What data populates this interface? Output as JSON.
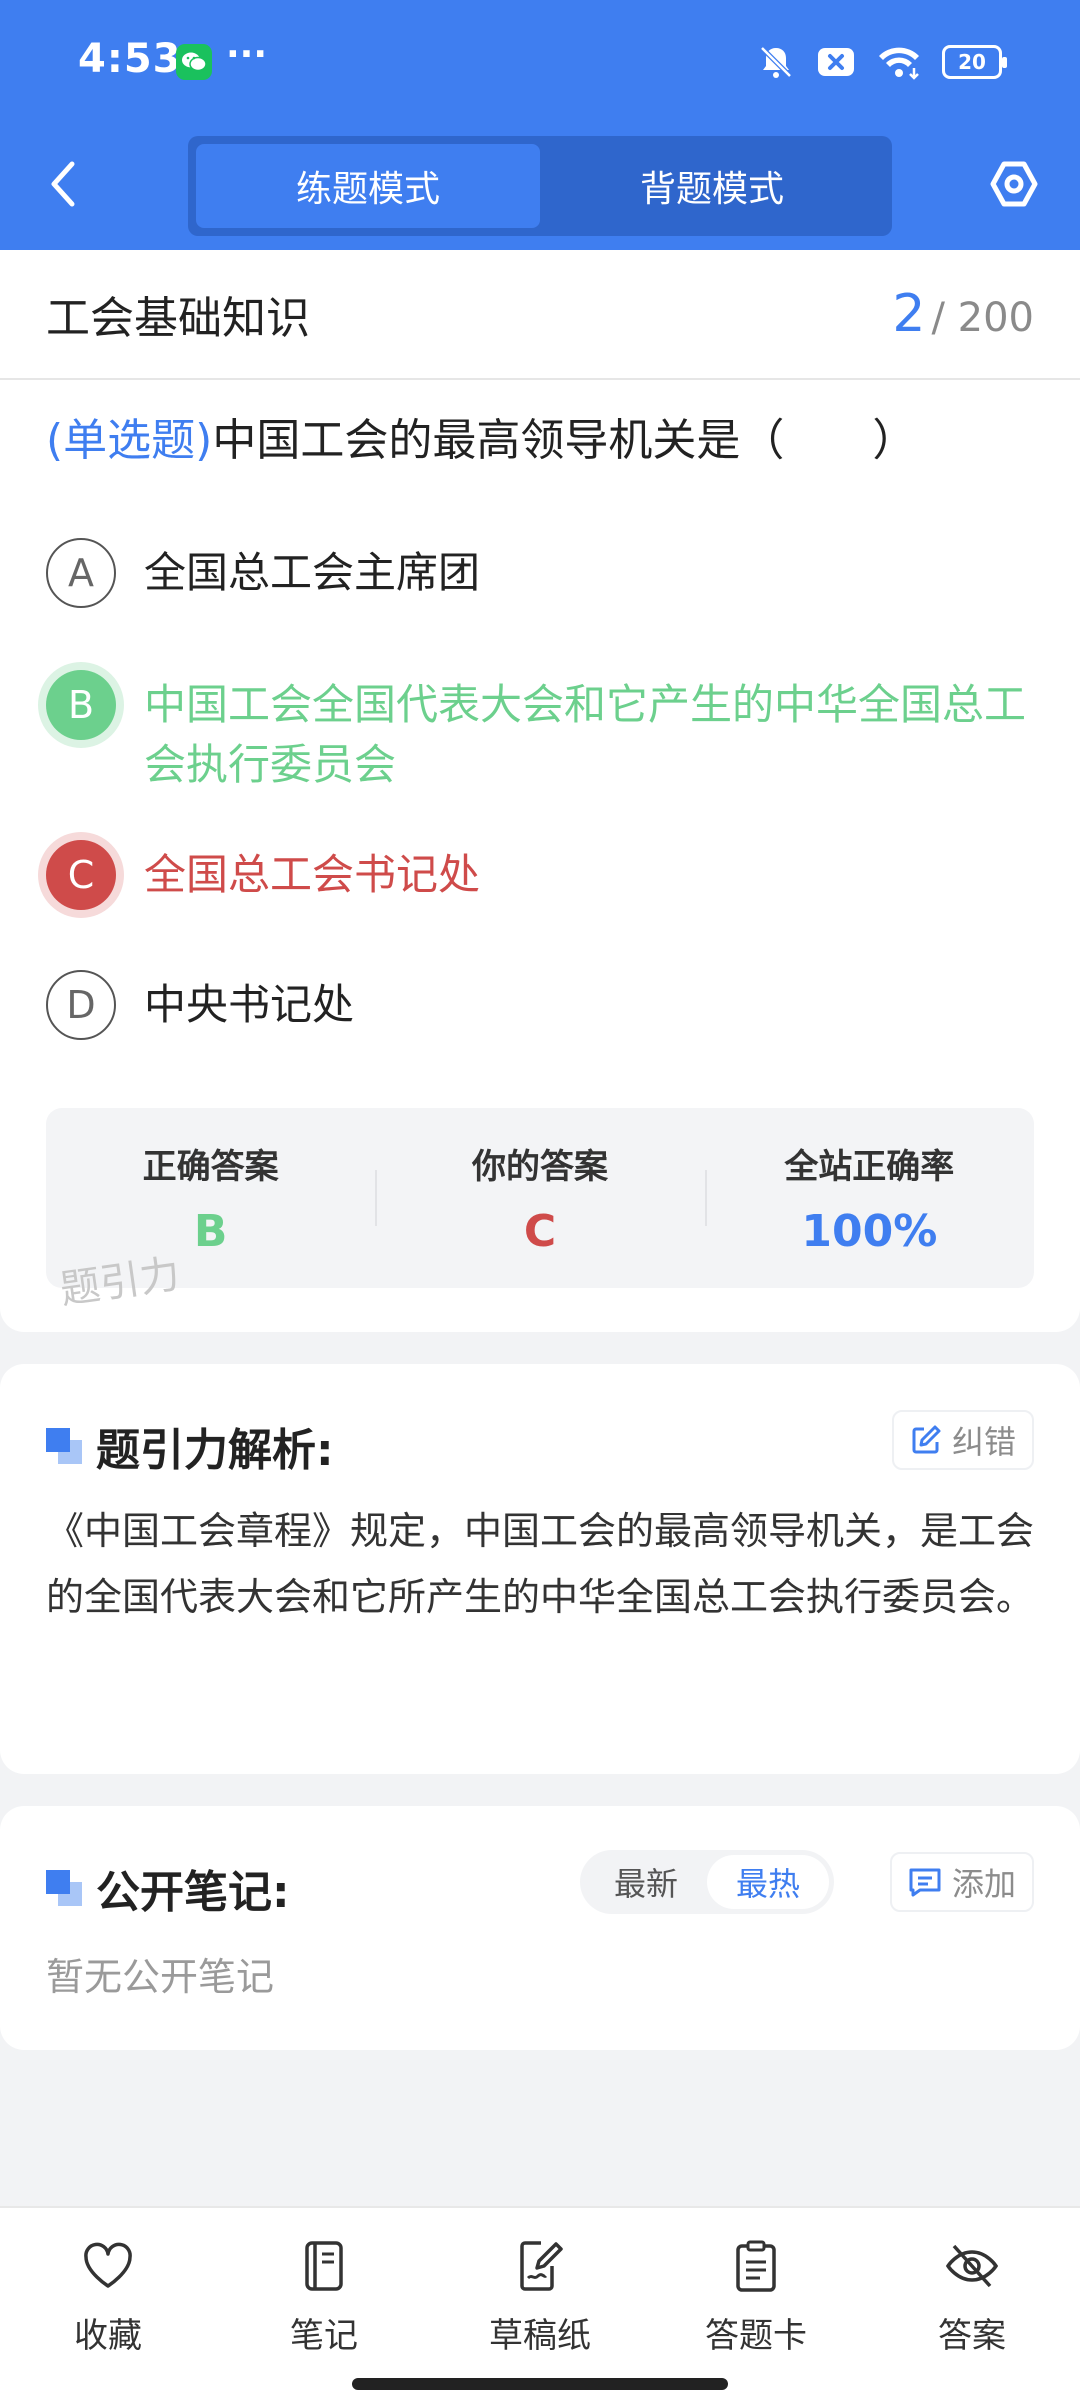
{
  "status_bar": {
    "time": "4:53",
    "dots": "···",
    "battery": "20"
  },
  "header": {
    "tabs": [
      "练题模式",
      "背题模式"
    ],
    "active_tab": 0
  },
  "subject": {
    "title": "工会基础知识",
    "current": "2",
    "total": "/ 200"
  },
  "question": {
    "type_label": "(单选题)",
    "text": "中国工会的最高领导机关是（　　）",
    "options": [
      {
        "letter": "A",
        "text": "全国总工会主席团",
        "state": "normal"
      },
      {
        "letter": "B",
        "text": "中国工会全国代表大会和它产生的中华全国总工会执行委员会",
        "state": "correct"
      },
      {
        "letter": "C",
        "text": "全国总工会书记处",
        "state": "wrong"
      },
      {
        "letter": "D",
        "text": "中央书记处",
        "state": "normal"
      }
    ]
  },
  "answer_summary": {
    "correct_label": "正确答案",
    "correct_value": "B",
    "yours_label": "你的答案",
    "yours_value": "C",
    "rate_label": "全站正确率",
    "rate_value": "100%"
  },
  "watermark": "题引力",
  "analysis": {
    "title": "题引力解析:",
    "report_label": "纠错",
    "text": "《中国工会章程》规定，中国工会的最高领导机关，是工会的全国代表大会和它所产生的中华全国总工会执行委员会。"
  },
  "notes": {
    "title": "公开笔记:",
    "sort_options": [
      "最新",
      "最热"
    ],
    "active_sort": 1,
    "add_label": "添加",
    "empty_text": "暂无公开笔记"
  },
  "bottom_nav": [
    {
      "label": "收藏",
      "icon": "heart-icon"
    },
    {
      "label": "笔记",
      "icon": "notebook-icon"
    },
    {
      "label": "草稿纸",
      "icon": "draft-paper-icon"
    },
    {
      "label": "答题卡",
      "icon": "answer-card-icon"
    },
    {
      "label": "答案",
      "icon": "eye-off-icon"
    }
  ],
  "colors": {
    "brand_blue": "#3f7ef0",
    "correct_green": "#6cd08d",
    "wrong_red": "#cf4b4a"
  }
}
